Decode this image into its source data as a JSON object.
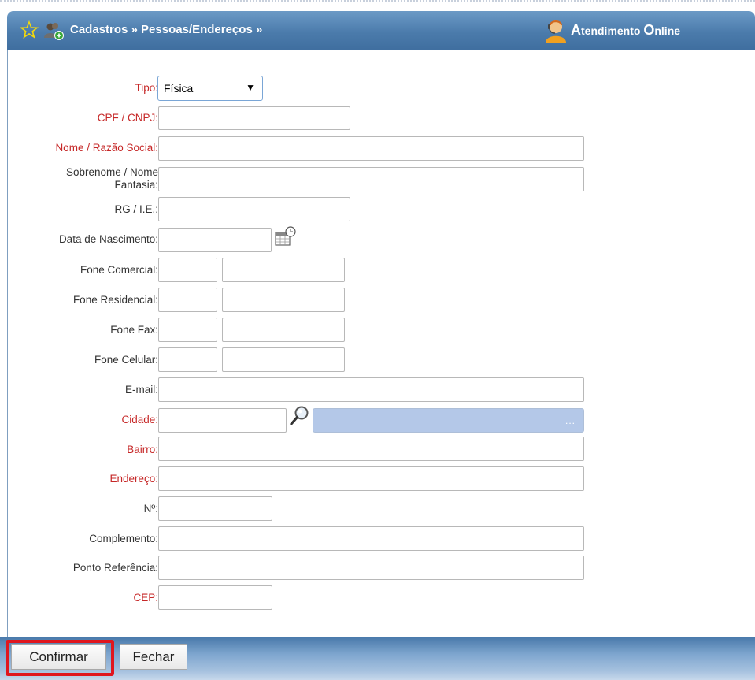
{
  "header": {
    "breadcrumb": "Cadastros » Pessoas/Endereços »",
    "online_first_A": "A",
    "online_rest1": "tendimento ",
    "online_O": "O",
    "online_rest2": "nline"
  },
  "form": {
    "tipo_label": "Tipo:",
    "tipo_value": "Física",
    "cpf_label": "CPF / CNPJ:",
    "nome_label": "Nome / Razão Social:",
    "sobrenome_label_line1": "Sobrenome / Nome",
    "sobrenome_label_line2": "Fantasia:",
    "rg_label": "RG / I.E.:",
    "nascimento_label": "Data de Nascimento:",
    "fone_comercial_label": "Fone Comercial:",
    "fone_residencial_label": "Fone Residencial:",
    "fone_fax_label": "Fone Fax:",
    "fone_celular_label": "Fone Celular:",
    "email_label": "E-mail:",
    "cidade_label": "Cidade:",
    "cidade_dots": "...",
    "bairro_label": "Bairro:",
    "endereco_label": "Endereço:",
    "numero_label": "Nº:",
    "complemento_label": "Complemento:",
    "ponto_label": "Ponto Referência:",
    "cep_label": "CEP:"
  },
  "footer": {
    "confirm_label": "Confirmar",
    "close_label": "Fechar"
  },
  "colors": {
    "header": "#4b7bab",
    "required_label": "#c62828",
    "highlight": "#e0161e",
    "city_field": "#b4c8e8"
  }
}
